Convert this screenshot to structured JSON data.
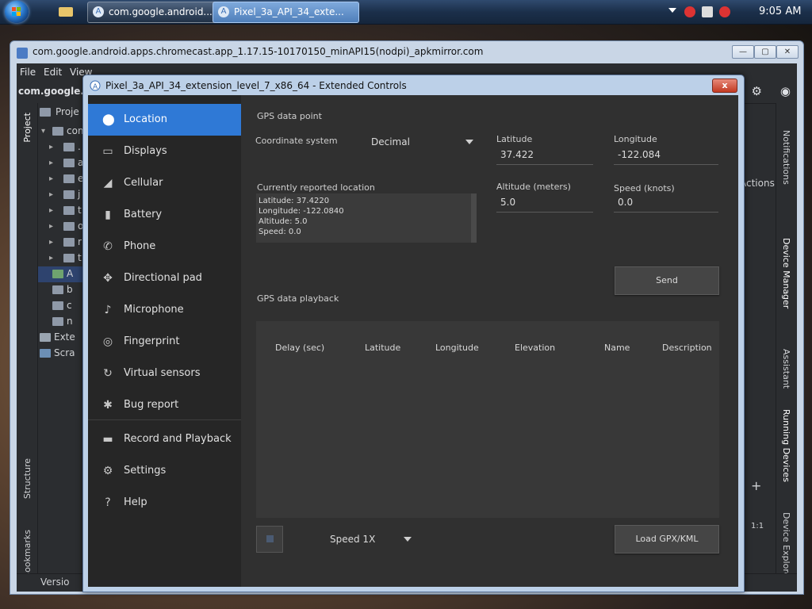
{
  "taskbar": {
    "tasks": [
      {
        "label": "com.google.android...."
      },
      {
        "label": "Pixel_3a_API_34_exte..."
      }
    ],
    "clock": "9:05 AM"
  },
  "studio": {
    "title": "com.google.android.apps.chromecast.app_1.17.15-10170150_minAPI15(nodpi)_apkmirror.com",
    "menu": [
      "File",
      "Edit",
      "View"
    ],
    "project_name": "com.google.a",
    "project_tab": "Proje",
    "left_strip": {
      "project": "Project",
      "structure": "Structure",
      "bookmarks": "Bookmarks"
    },
    "right_strip": [
      "Notifications",
      "Device Manager",
      "Assistant",
      "Running Devices",
      "Device Explorer"
    ],
    "actions_label": "Actions",
    "tree": [
      {
        "label": "com"
      },
      {
        "label": "."
      },
      {
        "label": "a"
      },
      {
        "label": "e"
      },
      {
        "label": "j"
      },
      {
        "label": "t"
      },
      {
        "label": "o"
      },
      {
        "label": "r"
      },
      {
        "label": "t"
      }
    ],
    "tree_bottom": [
      "A",
      "b",
      "c",
      "n"
    ],
    "external_label": "Exte",
    "scratches_label": "Scra",
    "version_label": "Versio",
    "zoom_ratio": "1:1"
  },
  "dialog": {
    "title": "Pixel_3a_API_34_extension_level_7_x86_64 - Extended Controls",
    "close": "x",
    "nav": [
      {
        "label": "Location",
        "icon": "location-pin-icon",
        "glyph": "⬤"
      },
      {
        "label": "Displays",
        "icon": "display-icon",
        "glyph": "▭"
      },
      {
        "label": "Cellular",
        "icon": "cellular-signal-icon",
        "glyph": "◢"
      },
      {
        "label": "Battery",
        "icon": "battery-icon",
        "glyph": "▮"
      },
      {
        "label": "Phone",
        "icon": "phone-icon",
        "glyph": "✆"
      },
      {
        "label": "Directional pad",
        "icon": "dpad-icon",
        "glyph": "✥"
      },
      {
        "label": "Microphone",
        "icon": "microphone-icon",
        "glyph": "♪"
      },
      {
        "label": "Fingerprint",
        "icon": "fingerprint-icon",
        "glyph": "◎"
      },
      {
        "label": "Virtual sensors",
        "icon": "sensors-icon",
        "glyph": "↻"
      },
      {
        "label": "Bug report",
        "icon": "bug-icon",
        "glyph": "✱"
      },
      {
        "label": "Record and Playback",
        "icon": "record-icon",
        "glyph": "▬"
      },
      {
        "label": "Settings",
        "icon": "gear-icon",
        "glyph": "⚙"
      },
      {
        "label": "Help",
        "icon": "help-icon",
        "glyph": "?"
      }
    ],
    "location": {
      "gps_point_label": "GPS data point",
      "coord_system_label": "Coordinate system",
      "coord_system_value": "Decimal",
      "latitude_label": "Latitude",
      "latitude_value": "37.422",
      "longitude_label": "Longitude",
      "longitude_value": "-122.084",
      "altitude_label": "Altitude (meters)",
      "altitude_value": "5.0",
      "speed_label": "Speed (knots)",
      "speed_value": "0.0",
      "reported_label": "Currently reported location",
      "reported_lines": [
        "Latitude: 37.4220",
        "Longitude: -122.0840",
        "Altitude: 5.0",
        "Speed: 0.0"
      ],
      "send_label": "Send",
      "playback_label": "GPS data playback",
      "columns": [
        "Delay (sec)",
        "Latitude",
        "Longitude",
        "Elevation",
        "Name",
        "Description"
      ],
      "speed_select": "Speed 1X",
      "load_label": "Load GPX/KML"
    }
  },
  "colors": {
    "accent": "#2f79d6",
    "dialog_bg": "#303030",
    "nav_bg": "#262626"
  }
}
